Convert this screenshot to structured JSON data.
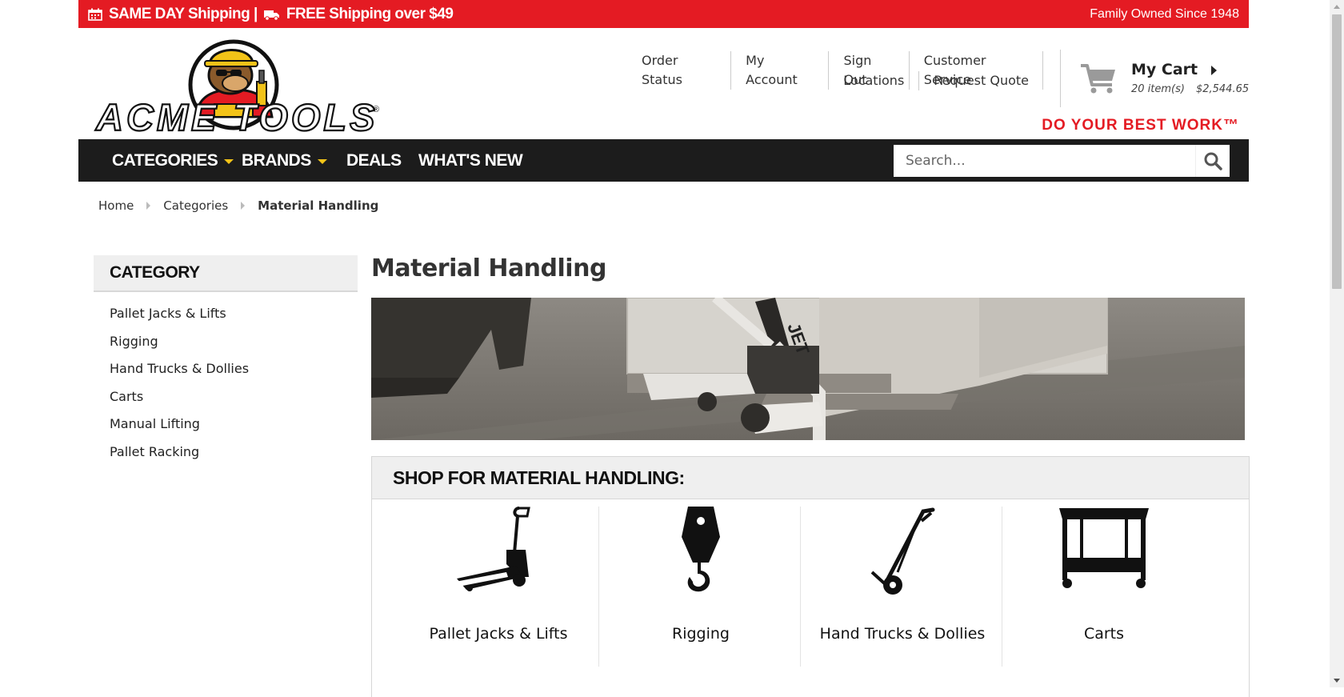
{
  "promo": {
    "left_text": "SAME DAY Shipping | ",
    "left_text_2": "FREE Shipping over $49",
    "right_text": "Family Owned Since 1948"
  },
  "logo": {
    "text": "ACME TOOLS",
    "registered": "®"
  },
  "top_links": {
    "order_status": "Order Status",
    "my_account": "My Account",
    "sign_out": "Sign Out",
    "customer_service": "Customer Service",
    "locations": "Locations",
    "request_quote": "Request Quote"
  },
  "cart": {
    "title": "My Cart",
    "items": "20 item(s)",
    "total": "$2,544.65"
  },
  "tagline": "DO YOUR BEST WORK™",
  "nav": {
    "categories": "CATEGORIES",
    "brands": "BRANDS",
    "deals": "DEALS",
    "whats_new": "WHAT'S NEW"
  },
  "search": {
    "placeholder": "Search..."
  },
  "breadcrumb": {
    "home": "Home",
    "categories": "Categories",
    "current": "Material Handling"
  },
  "sidebar": {
    "heading": "CATEGORY",
    "items": [
      "Pallet Jacks & Lifts",
      "Rigging",
      "Hand Trucks & Dollies",
      "Carts",
      "Manual Lifting",
      "Pallet Racking"
    ]
  },
  "page_title": "Material Handling",
  "shop": {
    "heading": "SHOP FOR MATERIAL HANDLING:",
    "tiles": [
      {
        "label": "Pallet Jacks & Lifts",
        "icon": "pallet-jack-icon"
      },
      {
        "label": "Rigging",
        "icon": "crane-hook-icon"
      },
      {
        "label": "Hand Trucks & Dollies",
        "icon": "hand-truck-icon"
      },
      {
        "label": "Carts",
        "icon": "utility-cart-icon"
      }
    ]
  },
  "colors": {
    "brand_red": "#e41b23",
    "nav_dark": "#1c1c1c",
    "accent_yellow": "#f2c318"
  }
}
